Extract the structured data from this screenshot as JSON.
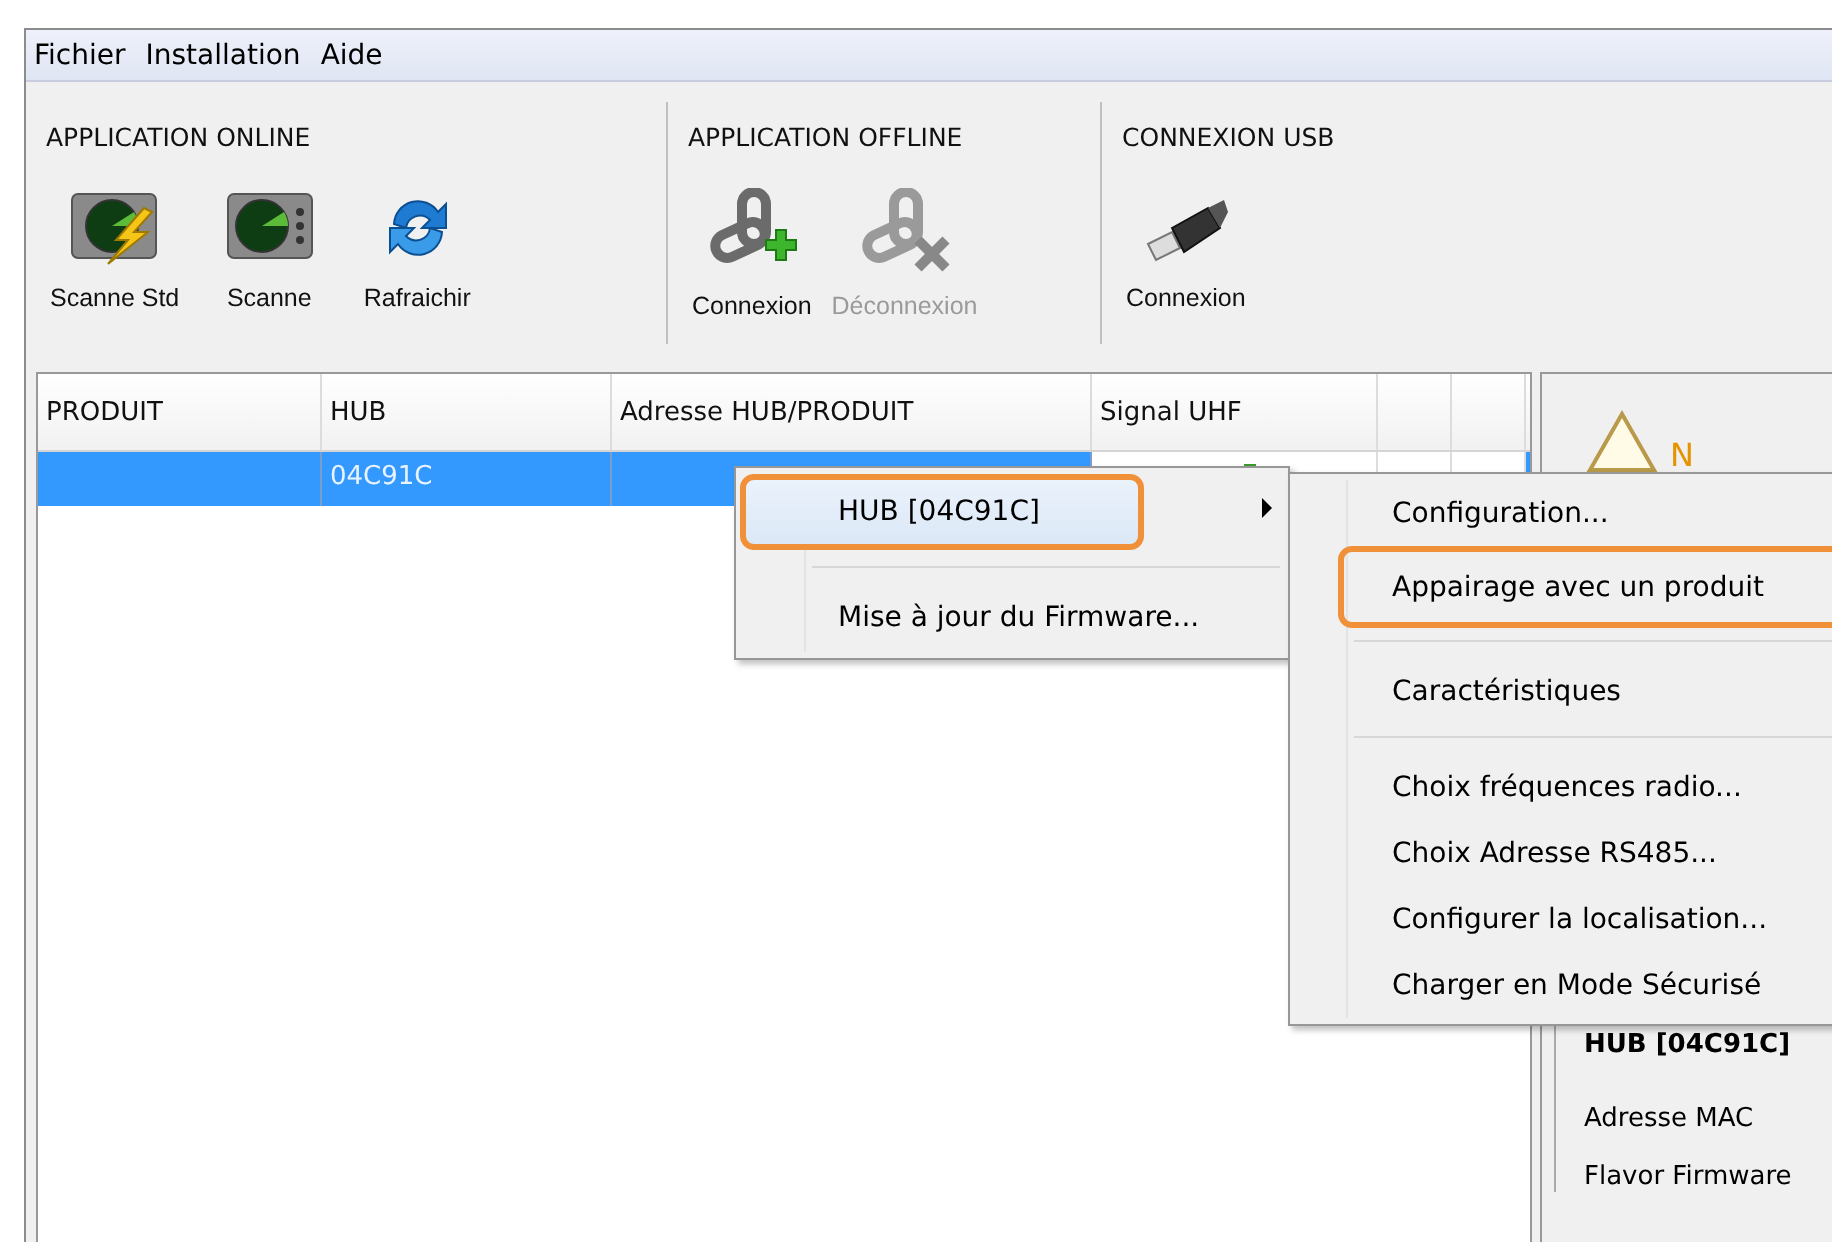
{
  "menu_bar": [
    {
      "label": "Fichier"
    },
    {
      "label": "Installation"
    },
    {
      "label": "Aide"
    }
  ],
  "toolbar": {
    "groups": [
      {
        "title": "APPLICATION ONLINE",
        "buttons": [
          {
            "label": "Scanne Std",
            "kind": "radar-bolt",
            "disabled": false
          },
          {
            "label": "Scanne",
            "kind": "radar",
            "disabled": false
          },
          {
            "label": "Rafraichir",
            "kind": "refresh",
            "disabled": false
          }
        ]
      },
      {
        "title": "APPLICATION OFFLINE",
        "buttons": [
          {
            "label": "Connexion",
            "kind": "link-add",
            "disabled": false
          },
          {
            "label": "Déconnexion",
            "kind": "link-remove",
            "disabled": true
          }
        ]
      },
      {
        "title": "CONNEXION USB",
        "buttons": [
          {
            "label": "Connexion",
            "kind": "usb",
            "disabled": false
          }
        ]
      }
    ]
  },
  "table": {
    "columns": [
      "PRODUIT",
      "HUB",
      "Adresse HUB/PRODUIT",
      "Signal UHF"
    ],
    "rows": [
      {
        "selected": true,
        "hub": "04C91C"
      }
    ]
  },
  "details_panel": {
    "warning_text": "N",
    "title": "HUB [04C91C]",
    "fields": [
      "Adresse MAC",
      "Flavor Firmware"
    ]
  },
  "context_menu": {
    "items": [
      {
        "label": "HUB [04C91C]",
        "highlighted": true,
        "has_submenu": true,
        "callout": true
      },
      {
        "label": "Mise à jour du Firmware...",
        "highlighted": false,
        "has_submenu": false,
        "callout": false
      }
    ]
  },
  "submenu": {
    "groups": [
      [
        {
          "label": "Configuration...",
          "callout": false
        },
        {
          "label": "Appairage avec un produit",
          "callout": true
        }
      ],
      [
        {
          "label": "Caractéristiques",
          "callout": false
        }
      ],
      [
        {
          "label": "Choix fréquences radio...",
          "callout": false
        },
        {
          "label": "Choix Adresse RS485...",
          "callout": false
        },
        {
          "label": "Configurer la localisation...",
          "callout": false
        },
        {
          "label": "Charger en Mode Sécurisé",
          "callout": false
        }
      ]
    ]
  }
}
